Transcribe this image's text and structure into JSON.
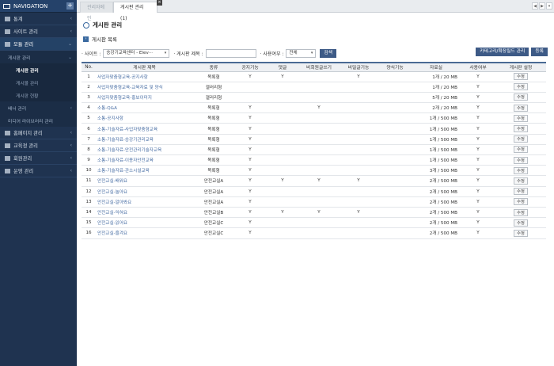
{
  "nav": {
    "title": "NAVIGATION",
    "plus": "+",
    "items": [
      {
        "label": "통계",
        "icon": "monitor-icon"
      },
      {
        "label": "사이트 관리",
        "icon": "home-icon"
      },
      {
        "label": "모듈 관리",
        "icon": "edit-icon"
      }
    ],
    "module_sub": [
      {
        "label": "게시판 관리"
      }
    ],
    "board_sub": [
      {
        "label": "게시판 관리",
        "active": true
      },
      {
        "label": "게시물 관리"
      },
      {
        "label": "게시판 현황"
      }
    ],
    "module_sub2": [
      {
        "label": "배너 관리"
      },
      {
        "label": "미디어 라이브러리 관리"
      }
    ],
    "items2": [
      {
        "label": "홈페이지 관리",
        "icon": "globe-icon"
      },
      {
        "label": "교육정 관리",
        "icon": "book-icon"
      },
      {
        "label": "회원관리",
        "icon": "users-icon"
      },
      {
        "label": "운영 관리",
        "icon": "gear-icon"
      }
    ]
  },
  "tabs": {
    "tab1": "관리자메인",
    "tab2": "게시판 관리 (1)",
    "close": "×",
    "nav_left": "◀",
    "nav_right": "▶",
    "nav_menu": "▾"
  },
  "page": {
    "title": "게시판 관리",
    "section": "게시판 목록",
    "section_icon": "›"
  },
  "filter": {
    "site_label": "· 사이트 :",
    "site_value": "승강기교육센터 - Elev···",
    "name_label": "· 게시판 제목 :",
    "name_value": "",
    "use_label": "· 사용여부 :",
    "use_value": "전체",
    "search_btn": "검색",
    "arrow": "▾"
  },
  "buttons": {
    "category": "카테고리/확장필드 관리",
    "register": "등록"
  },
  "table": {
    "headers": [
      "No.",
      "게시판 제목",
      "종류",
      "공지기능",
      "댓글",
      "비회원글쓰기",
      "비밀글기능",
      "양식기능",
      "자료실",
      "사용여부",
      "게시판 설정"
    ],
    "edit_label": "수정",
    "rows": [
      {
        "no": "1",
        "title": "사업자맞춤형교육-공지사항",
        "type": "목록형",
        "notice": "Y",
        "comment": "Y",
        "guest": "",
        "secret": "Y",
        "form": "",
        "cap": "1개 / 20 MB",
        "use": "Y"
      },
      {
        "no": "2",
        "title": "사업자맞춤형교육-교육자료 및 양식",
        "type": "갤러리형",
        "notice": "",
        "comment": "",
        "guest": "",
        "secret": "",
        "form": "",
        "cap": "1개 / 20 MB",
        "use": "Y"
      },
      {
        "no": "3",
        "title": "사업자맞춤형교육-홍보이미지",
        "type": "갤러리형",
        "notice": "",
        "comment": "",
        "guest": "",
        "secret": "",
        "form": "",
        "cap": "5개 / 20 MB",
        "use": "Y"
      },
      {
        "no": "4",
        "title": "소통-Q&A",
        "type": "목록형",
        "notice": "Y",
        "comment": "",
        "guest": "Y",
        "secret": "",
        "form": "",
        "cap": "2개 / 20 MB",
        "use": "Y"
      },
      {
        "no": "5",
        "title": "소통-공지사항",
        "type": "목록형",
        "notice": "Y",
        "comment": "",
        "guest": "",
        "secret": "",
        "form": "",
        "cap": "1개 / 500 MB",
        "use": "Y"
      },
      {
        "no": "6",
        "title": "소통-기술자료-사업자맞춤형교육",
        "type": "목록형",
        "notice": "Y",
        "comment": "",
        "guest": "",
        "secret": "",
        "form": "",
        "cap": "1개 / 500 MB",
        "use": "Y"
      },
      {
        "no": "7",
        "title": "소통-기술자료-승강기관리교육",
        "type": "목록형",
        "notice": "Y",
        "comment": "",
        "guest": "",
        "secret": "",
        "form": "",
        "cap": "1개 / 500 MB",
        "use": "Y"
      },
      {
        "no": "8",
        "title": "소통-기술자료-안전관리기술자교육",
        "type": "목록형",
        "notice": "Y",
        "comment": "",
        "guest": "",
        "secret": "",
        "form": "",
        "cap": "1개 / 500 MB",
        "use": "Y"
      },
      {
        "no": "9",
        "title": "소통-기술자료-이용자안전교육",
        "type": "목록형",
        "notice": "Y",
        "comment": "",
        "guest": "",
        "secret": "",
        "form": "",
        "cap": "1개 / 500 MB",
        "use": "Y"
      },
      {
        "no": "10",
        "title": "소통-기술자료-관소시설교육",
        "type": "목록형",
        "notice": "Y",
        "comment": "",
        "guest": "",
        "secret": "",
        "form": "",
        "cap": "3개 / 500 MB",
        "use": "Y"
      },
      {
        "no": "11",
        "title": "안전교실-배워요",
        "type": "안전교실A",
        "notice": "Y",
        "comment": "Y",
        "guest": "Y",
        "secret": "Y",
        "form": "",
        "cap": "2개 / 500 MB",
        "use": "Y"
      },
      {
        "no": "12",
        "title": "안전교실-놀아요",
        "type": "안전교실A",
        "notice": "Y",
        "comment": "",
        "guest": "",
        "secret": "",
        "form": "",
        "cap": "2개 / 500 MB",
        "use": "Y"
      },
      {
        "no": "13",
        "title": "안전교실-알아봐요",
        "type": "안전교실A",
        "notice": "Y",
        "comment": "",
        "guest": "",
        "secret": "",
        "form": "",
        "cap": "2개 / 500 MB",
        "use": "Y"
      },
      {
        "no": "14",
        "title": "안전교실-익혀요",
        "type": "안전교실B",
        "notice": "Y",
        "comment": "Y",
        "guest": "Y",
        "secret": "Y",
        "form": "",
        "cap": "2개 / 500 MB",
        "use": "Y"
      },
      {
        "no": "15",
        "title": "안전교실-읽어요",
        "type": "안전교실C",
        "notice": "Y",
        "comment": "",
        "guest": "",
        "secret": "",
        "form": "",
        "cap": "2개 / 500 MB",
        "use": "Y"
      },
      {
        "no": "16",
        "title": "안전교실-즐겨요",
        "type": "안전교실C",
        "notice": "Y",
        "comment": "",
        "guest": "",
        "secret": "",
        "form": "",
        "cap": "2개 / 500 MB",
        "use": "Y"
      }
    ]
  }
}
